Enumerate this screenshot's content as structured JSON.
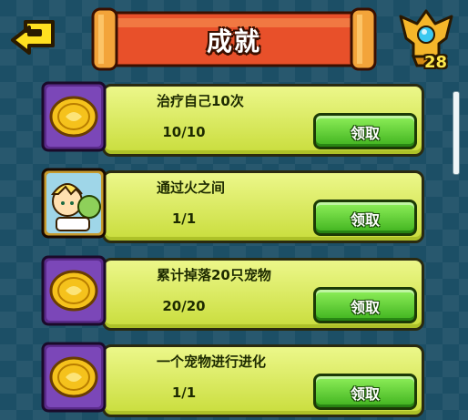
{
  "header": {
    "title": "成就",
    "back_icon": "back-arrow-icon",
    "trophy_icon": "trophy-icon",
    "trophy_count": "28"
  },
  "achievements": [
    {
      "title": "治疗自己10次",
      "progress": "10/10",
      "button": "领取",
      "icon": "gold-coin-icon"
    },
    {
      "title": "通过火之间",
      "progress": "1/1",
      "button": "领取",
      "icon": "character-portrait-icon"
    },
    {
      "title": "累计掉落20只宠物",
      "progress": "20/20",
      "button": "领取",
      "icon": "gold-coin-icon"
    },
    {
      "title": "一个宠物进行进化",
      "progress": "1/1",
      "button": "领取",
      "icon": "gold-coin-icon"
    }
  ],
  "colors": {
    "background": "#1c4f66",
    "card": "#d9e95a",
    "button": "#5acb2c",
    "banner": "#e8502a",
    "trophy_count": "#ffe84a"
  }
}
